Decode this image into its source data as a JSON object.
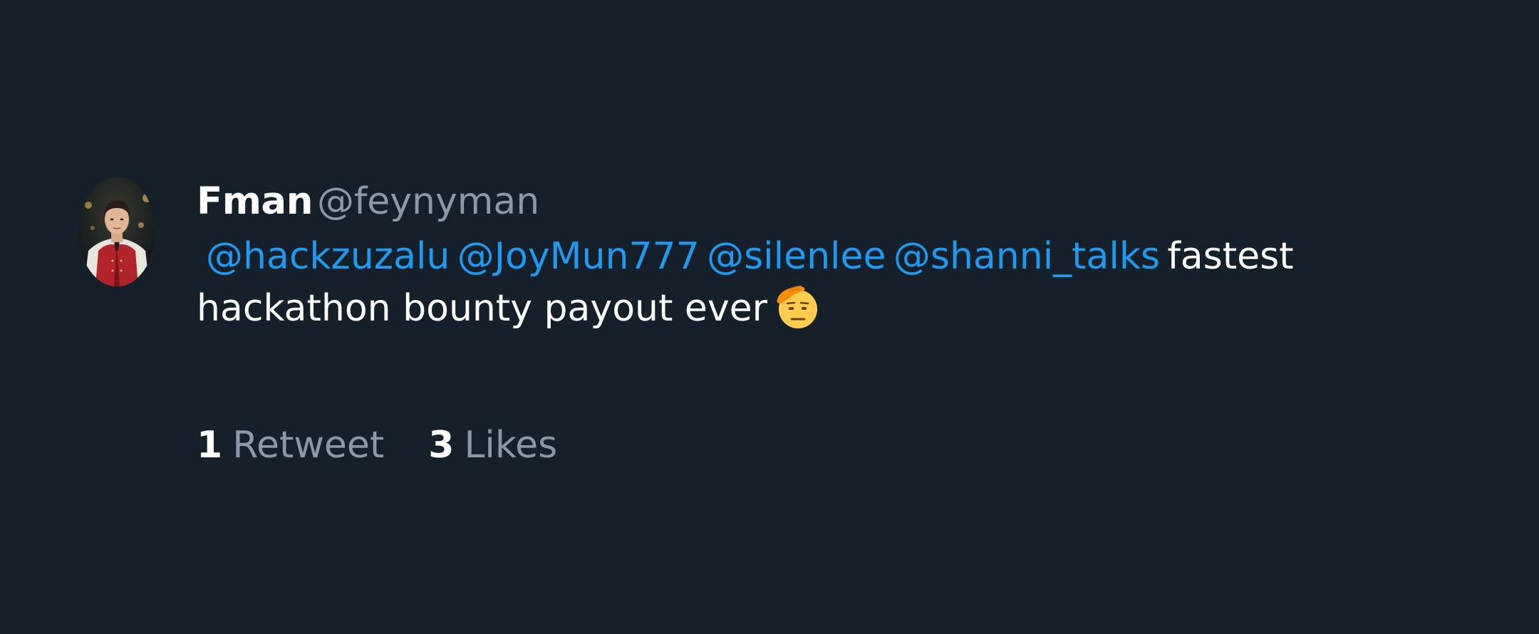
{
  "tweet": {
    "author": {
      "display_name": "Fman",
      "handle": "@feynyman",
      "avatar": "avatar-photo"
    },
    "mentions": [
      "@hackzuzalu",
      "@JoyMun777",
      "@silenlee",
      "@shanni_talks"
    ],
    "text_after_mentions": "fastest hackathon bounty payout ever",
    "emoji": "saluting-face-emoji",
    "stats": {
      "retweets": {
        "count": "1",
        "label": "Retweet"
      },
      "likes": {
        "count": "3",
        "label": "Likes"
      }
    }
  },
  "colors": {
    "background": "#16202a",
    "text_primary": "#ffffff",
    "text_secondary": "#8b98a5",
    "link": "#1d9bf0",
    "emoji_face": "#ffcc4d",
    "emoji_hand": "#f4900c"
  }
}
